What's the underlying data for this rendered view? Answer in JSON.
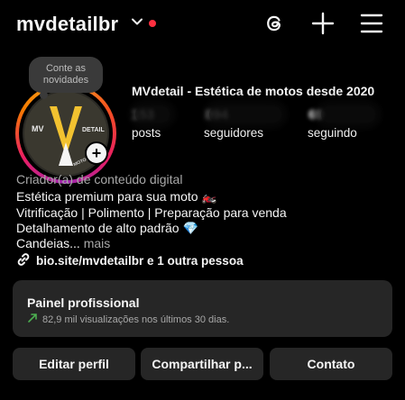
{
  "header": {
    "username": "mvdetailbr",
    "notification_dot_color": "#ff3040",
    "icons": [
      "threads-icon",
      "plus-icon",
      "hamburger-menu-icon"
    ]
  },
  "profile": {
    "note_text": "Conte as novidades",
    "display_name": "MVdetail - Estética de motos desde 2020",
    "avatar_text_left": "MV",
    "avatar_text_right": "DETAIL",
    "avatar_text_bottom": "MOTORCYCLE",
    "stats": [
      {
        "value": "153",
        "label": "posts"
      },
      {
        "value": "894",
        "label": "seguidores"
      },
      {
        "value": "69",
        "label": "seguindo"
      }
    ],
    "category": "Criador(a) de conteúdo digital",
    "bio": [
      "Estética premium para sua moto 🏍️",
      "Vitrificação | Polimento | Preparação para venda",
      "Detalhamento de alto padrão 💎",
      "Candeias..."
    ],
    "more_label": "mais",
    "link_text": "bio.site/mvdetailbr e 1 outra pessoa"
  },
  "dashboard": {
    "title": "Painel profissional",
    "subtitle": "82,9 mil visualizações nos últimos 30 dias.",
    "trend_color": "#4caf50"
  },
  "buttons": {
    "edit": "Editar perfil",
    "share": "Compartilhar p...",
    "contact": "Contato"
  }
}
